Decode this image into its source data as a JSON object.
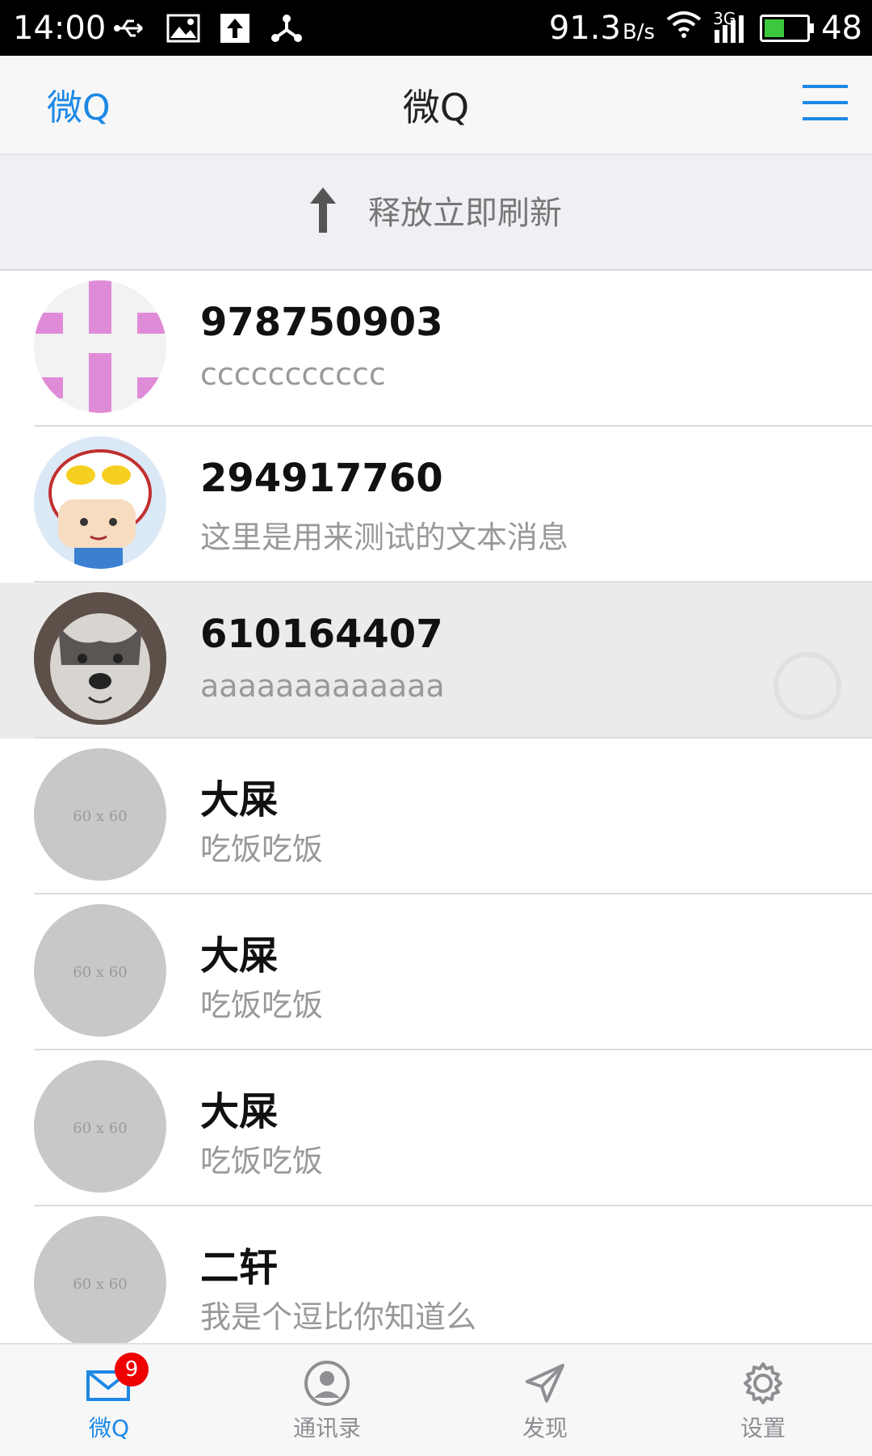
{
  "status_bar": {
    "time": "14:00",
    "speed": "91.3",
    "speed_unit": "B/s",
    "network": "3G",
    "battery_text": "48",
    "battery_level": 0.48,
    "icons": [
      "usb-icon",
      "image-icon",
      "upload-icon",
      "share-icon",
      "wifi-icon",
      "signal-icon",
      "battery-icon"
    ]
  },
  "header": {
    "left_label": "微Q",
    "title": "微Q",
    "menu_icon": "menu-icon",
    "accent_color": "#1e88e5"
  },
  "refresh": {
    "text": "释放立即刷新",
    "icon": "arrow-up-icon"
  },
  "conversations": [
    {
      "name": "978750903",
      "message": "ccccccccccc",
      "avatar": "pink-pattern"
    },
    {
      "name": "294917760",
      "message": "这里是用来测试的文本消息",
      "avatar": "cartoon-boy"
    },
    {
      "name": "610164407",
      "message": "aaaaaaaaaaaaa",
      "avatar": "husky-dog",
      "active": true
    },
    {
      "name": "大屎",
      "message": "吃饭吃饭",
      "avatar_placeholder": "60 x 60"
    },
    {
      "name": "大屎",
      "message": "吃饭吃饭",
      "avatar_placeholder": "60 x 60"
    },
    {
      "name": "大屎",
      "message": "吃饭吃饭",
      "avatar_placeholder": "60 x 60"
    },
    {
      "name": "二轩",
      "message": "我是个逗比你知道么",
      "avatar_placeholder": "60 x 60"
    }
  ],
  "tabs": [
    {
      "label": "微Q",
      "icon": "mail-icon",
      "badge": "9",
      "active": true
    },
    {
      "label": "通讯录",
      "icon": "contact-icon"
    },
    {
      "label": "发现",
      "icon": "send-icon"
    },
    {
      "label": "设置",
      "icon": "gear-icon"
    }
  ]
}
